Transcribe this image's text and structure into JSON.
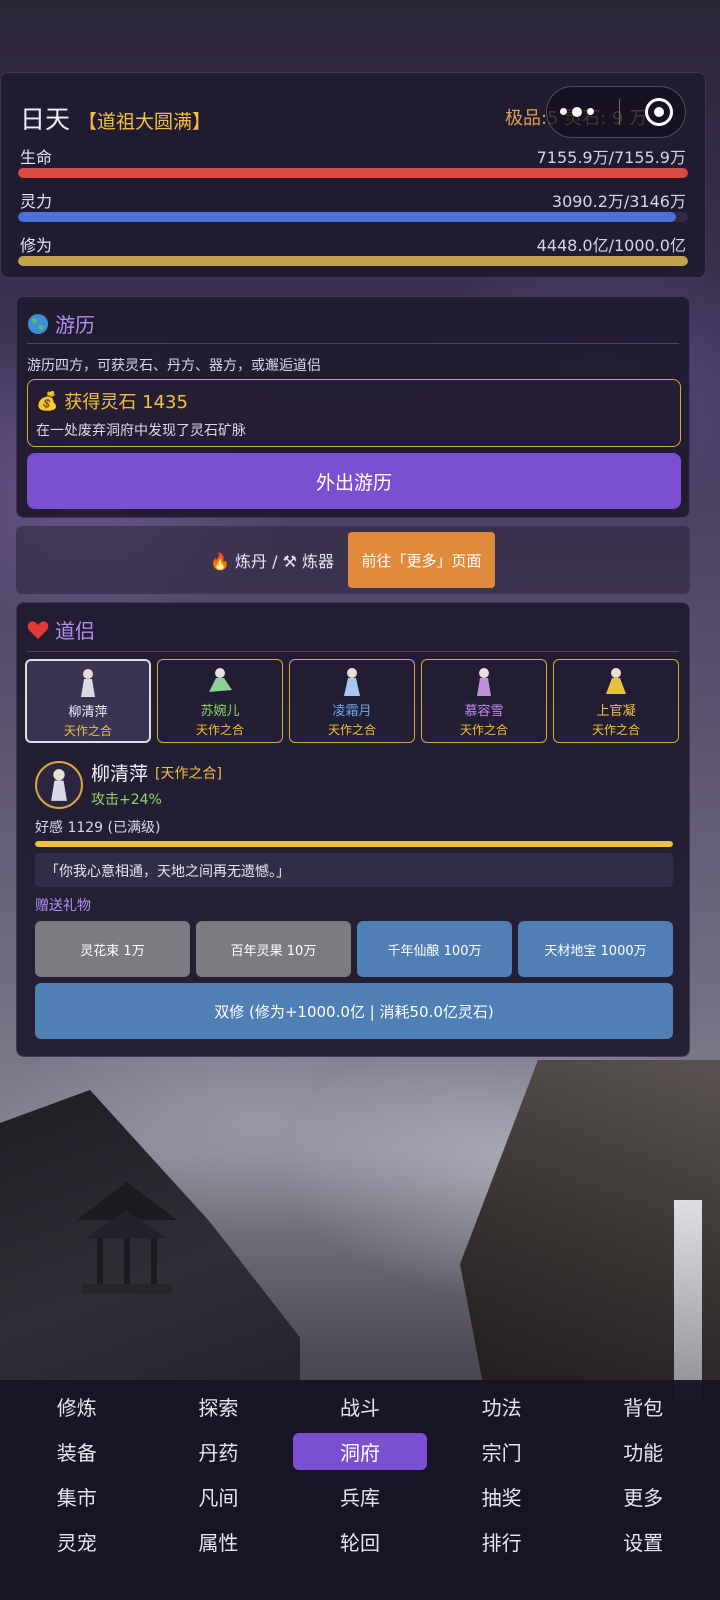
{
  "player": {
    "name": "日天",
    "realm": "【道祖大圆满】",
    "stone_summary": "极品:5   灵石: 9   万"
  },
  "stats": {
    "hp": {
      "label": "生命",
      "value": "7155.9万/7155.9万",
      "fill": 1.0
    },
    "mp": {
      "label": "灵力",
      "value": "3090.2万/3146万",
      "fill": 0.982
    },
    "xp": {
      "label": "修为",
      "value": "4448.0亿/1000.0亿",
      "fill": 1.0
    }
  },
  "travel": {
    "title": "游历",
    "icon": "globe-icon",
    "description": "游历四方，可获灵石、丹方、器方，或邂逅道侣",
    "reward_title": "获得灵石 1435",
    "reward_desc": "在一处废弃洞府中发现了灵石矿脉",
    "button": "外出游历"
  },
  "forge_strip": {
    "text": "炼丹 / ⚒ 炼器",
    "button": "前往「更多」页面"
  },
  "companion": {
    "title": "道侣",
    "icon": "heart-icon",
    "cards": [
      {
        "name": "柳清萍",
        "relation": "天作之合",
        "name_color": "#f2eef8"
      },
      {
        "name": "苏婉儿",
        "relation": "天作之合",
        "name_color": "#8fd86a"
      },
      {
        "name": "凌霜月",
        "relation": "天作之合",
        "name_color": "#6aa8f0"
      },
      {
        "name": "慕容雪",
        "relation": "天作之合",
        "name_color": "#c08ef0"
      },
      {
        "name": "上官凝",
        "relation": "天作之合",
        "name_color": "#f0c040"
      }
    ],
    "selected": {
      "name": "柳清萍",
      "relation": "[天作之合]",
      "bonus": "攻击+24%",
      "favor": "好感 1129 (已满级)",
      "favor_fill": 1.0,
      "quote": "「你我心意相通，天地之间再无遗憾。」"
    },
    "gift_label": "赠送礼物",
    "gifts": [
      {
        "label": "灵花束 1万",
        "style": "gray"
      },
      {
        "label": "百年灵果 10万",
        "style": "gray"
      },
      {
        "label": "千年仙酿 100万",
        "style": "blue"
      },
      {
        "label": "天材地宝 1000万",
        "style": "blue"
      }
    ],
    "dual_button": "双修 (修为+1000.0亿 | 消耗50.0亿灵石)"
  },
  "nav": {
    "active": "洞府",
    "items": [
      "修炼",
      "探索",
      "战斗",
      "功法",
      "背包",
      "装备",
      "丹药",
      "洞府",
      "宗门",
      "功能",
      "集市",
      "凡间",
      "兵库",
      "抽奖",
      "更多",
      "灵宠",
      "属性",
      "轮回",
      "排行",
      "设置"
    ]
  },
  "colors": {
    "accent_purple": "#7a4fd0",
    "gold": "#f0c040",
    "hp_red": "#d94a42",
    "mp_blue": "#4a72d8",
    "xp_gold": "#c2a24e",
    "orange_button": "#e08a3c",
    "gift_blue": "#4f7fb5"
  }
}
